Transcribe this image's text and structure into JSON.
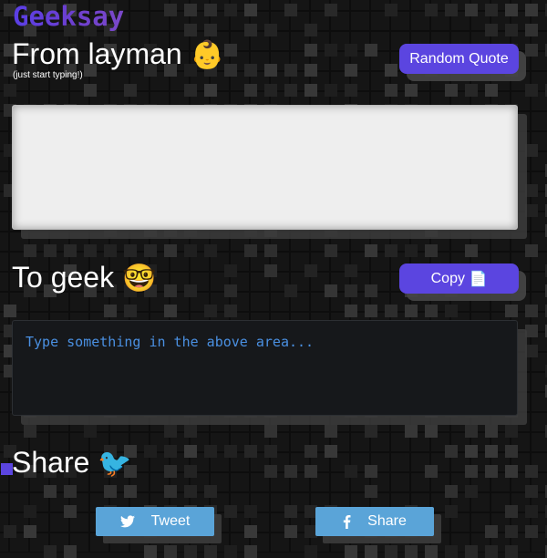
{
  "app": {
    "logo": "Geeksay"
  },
  "input_section": {
    "heading": "From layman",
    "heading_emoji": "👶",
    "subtext": "(just start typing!)",
    "random_button": "Random Quote",
    "value": ""
  },
  "output_section": {
    "heading": "To geek",
    "heading_emoji": "🤓",
    "copy_button": "Copy",
    "copy_icon": "📄",
    "placeholder_text": "Type something in the above area..."
  },
  "share_section": {
    "heading": "Share",
    "heading_emoji": "🐦",
    "tweet_button": "Tweet",
    "share_button": "Share",
    "tweet_icon": "twitter-bird-icon",
    "share_icon": "facebook-f-icon"
  },
  "colors": {
    "accent": "#5b45e0",
    "share_blue": "#5aa4d8",
    "output_text": "#4a90e2"
  }
}
